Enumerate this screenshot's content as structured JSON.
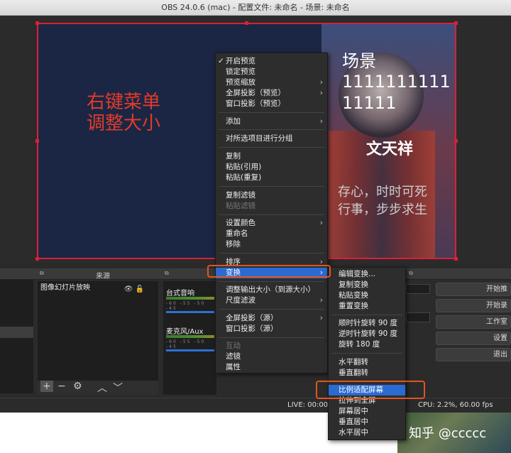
{
  "window": {
    "title": "OBS 24.0.6 (mac) - 配置文件: 未命名 - 场景: 未命名"
  },
  "canvas": {
    "red_text_line1": "右键菜单",
    "red_text_line2": "调整大小",
    "scene_title": "场景",
    "scene_number": "111111111111111",
    "scene_name": "文天祥",
    "quote_line1": "存心，时时可死",
    "quote_line2": "行事，步步求生"
  },
  "docks": {
    "sources_title": "来源",
    "source_item": "图像幻灯片放映",
    "mixer": {
      "track1": "台式音响",
      "track2": "麦克风/Aux",
      "scale": "-60 -55 -50 -45"
    },
    "controls": [
      "开始推",
      "开始录",
      "工作室",
      "设置",
      "退出"
    ]
  },
  "status": {
    "live": "LIVE: 00:00",
    "cpu": "CPU: 2.2%, 60.00 fps"
  },
  "watermark": "知乎 @ccccc",
  "context_menu": {
    "items": [
      "开启预览",
      "锁定预览",
      "预览缩放",
      "全屏投影（预览）",
      "窗口投影（预览）",
      "添加",
      "对所选项目进行分组",
      "复制",
      "粘贴(引用)",
      "粘贴(重复)",
      "复制滤镜",
      "粘贴滤镜",
      "设置颜色",
      "重命名",
      "移除",
      "排序",
      "变换",
      "调整输出大小（到源大小）",
      "尺度滤波",
      "全屏投影（源）",
      "窗口投影（源）",
      "互动",
      "滤镜",
      "属性"
    ],
    "check": "✓"
  },
  "transform_menu": {
    "items": [
      "编辑变换...",
      "复制变换",
      "粘贴变换",
      "重置变换",
      "顺时针旋转 90 度",
      "逆时针旋转 90 度",
      "旋转 180 度",
      "水平翻转",
      "垂直翻转",
      "比例适配屏幕",
      "拉伸到全屏",
      "屏幕居中",
      "垂直居中",
      "水平居中"
    ]
  },
  "colors": {
    "highlight": "#2b6bd1",
    "annotation": "#e2541e",
    "canvas_border": "#d9203a"
  }
}
